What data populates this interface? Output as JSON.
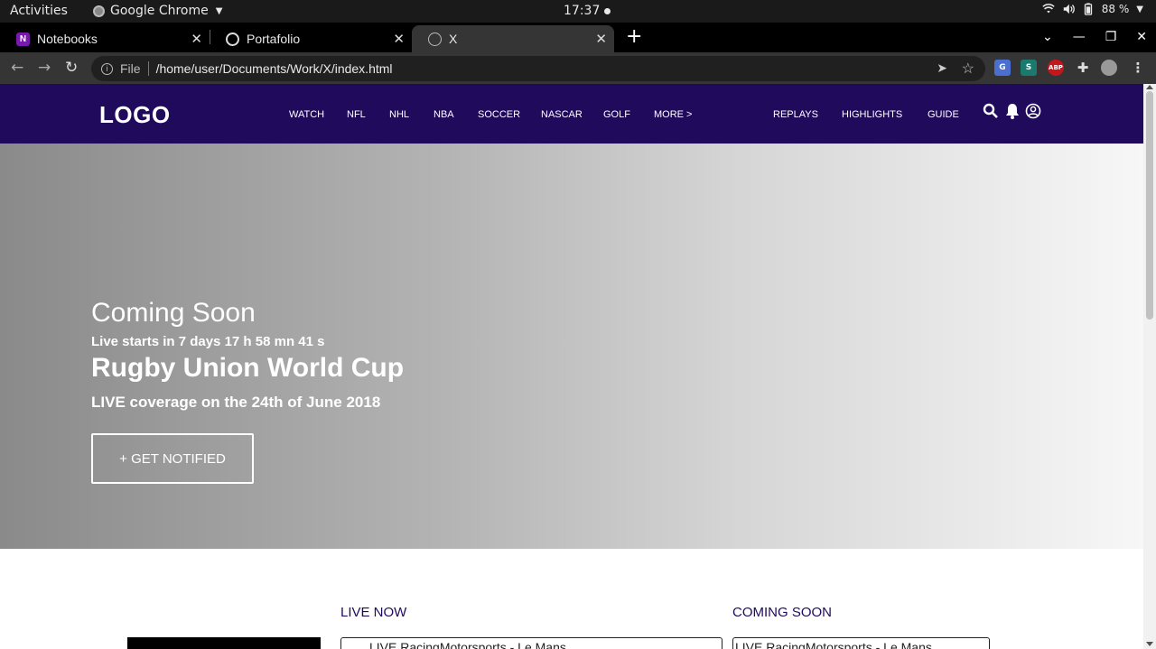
{
  "os_bar": {
    "activities": "Activities",
    "app_name": "Google Chrome",
    "clock": "17:37",
    "battery": "88 %"
  },
  "browser": {
    "tabs": [
      {
        "title": "Notebooks",
        "favicon": "onenote-icon"
      },
      {
        "title": "Portafolio",
        "favicon": "globe-icon"
      },
      {
        "title": "X",
        "favicon": "globe-icon",
        "active": true
      }
    ],
    "address": {
      "scheme_label": "File",
      "url": "/home/user/Documents/Work/X/index.html"
    },
    "extensions": [
      {
        "name": "translate-extension-icon",
        "label": "G",
        "color": "#4a6fd1"
      },
      {
        "name": "s-extension-icon",
        "label": "S",
        "color": "#1a7a6e"
      },
      {
        "name": "adblock-plus-icon",
        "label": "ABP",
        "color": "#c4161c"
      },
      {
        "name": "puzzle-extensions-icon",
        "label": "",
        "color": "#353535"
      }
    ]
  },
  "site": {
    "logo": "LOGO",
    "nav_left": [
      "WATCH",
      "NFL",
      "NHL",
      "NBA",
      "SOCCER",
      "NASCAR",
      "GOLF",
      "MORE >"
    ],
    "nav_right": [
      "REPLAYS",
      "HIGHLIGHTS",
      "GUIDE"
    ],
    "accent_color": "#200a5c"
  },
  "hero": {
    "status": "Coming Soon",
    "countdown": "Live starts in 7 days 17 h 58 mn 41 s",
    "event_title": "Rugby Union World Cup",
    "coverage": "LIVE coverage on the 24th of June 2018",
    "notify_button": "+ GET NOTIFIED"
  },
  "sections": {
    "live_now": {
      "title": "LIVE NOW",
      "first_item": "LIVE RacingMotorsports - Le Mans"
    },
    "coming_soon": {
      "title": "COMING SOON",
      "first_item": "LIVE RacingMotorsports - Le Mans"
    }
  }
}
